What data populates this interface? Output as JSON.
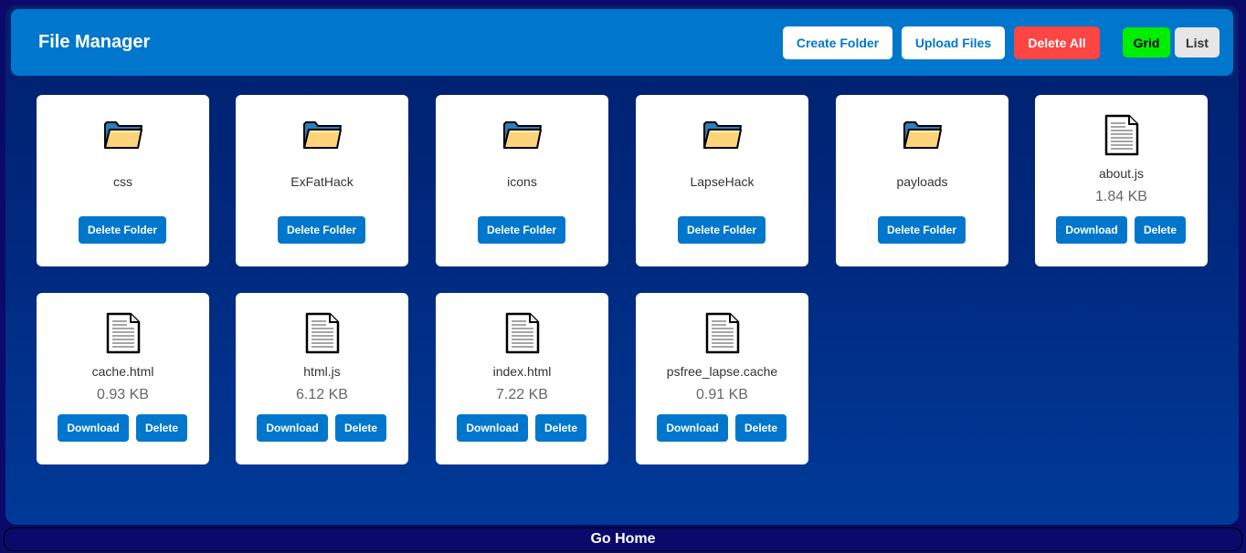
{
  "header": {
    "title": "File Manager",
    "create_folder": "Create Folder",
    "upload_files": "Upload Files",
    "delete_all": "Delete All",
    "grid": "Grid",
    "list": "List"
  },
  "folders": [
    {
      "name": "css",
      "action": "Delete Folder"
    },
    {
      "name": "ExFatHack",
      "action": "Delete Folder"
    },
    {
      "name": "icons",
      "action": "Delete Folder"
    },
    {
      "name": "LapseHack",
      "action": "Delete Folder"
    },
    {
      "name": "payloads",
      "action": "Delete Folder"
    }
  ],
  "files": [
    {
      "name": "about.js",
      "size": "1.84 KB",
      "download": "Download",
      "delete": "Delete"
    },
    {
      "name": "cache.html",
      "size": "0.93 KB",
      "download": "Download",
      "delete": "Delete"
    },
    {
      "name": "html.js",
      "size": "6.12 KB",
      "download": "Download",
      "delete": "Delete"
    },
    {
      "name": "index.html",
      "size": "7.22 KB",
      "download": "Download",
      "delete": "Delete"
    },
    {
      "name": "psfree_lapse.cache",
      "size": "0.91 KB",
      "download": "Download",
      "delete": "Delete"
    }
  ],
  "footer": {
    "go_home": "Go Home"
  },
  "colors": {
    "header_bg": "#0077cc",
    "button_blue": "#0077cc",
    "delete_all_red": "#ff4444",
    "grid_green": "#00ee00",
    "page_bg": "#0b0a6a"
  },
  "icons": {
    "folder": "folder-icon",
    "file": "file-icon"
  }
}
